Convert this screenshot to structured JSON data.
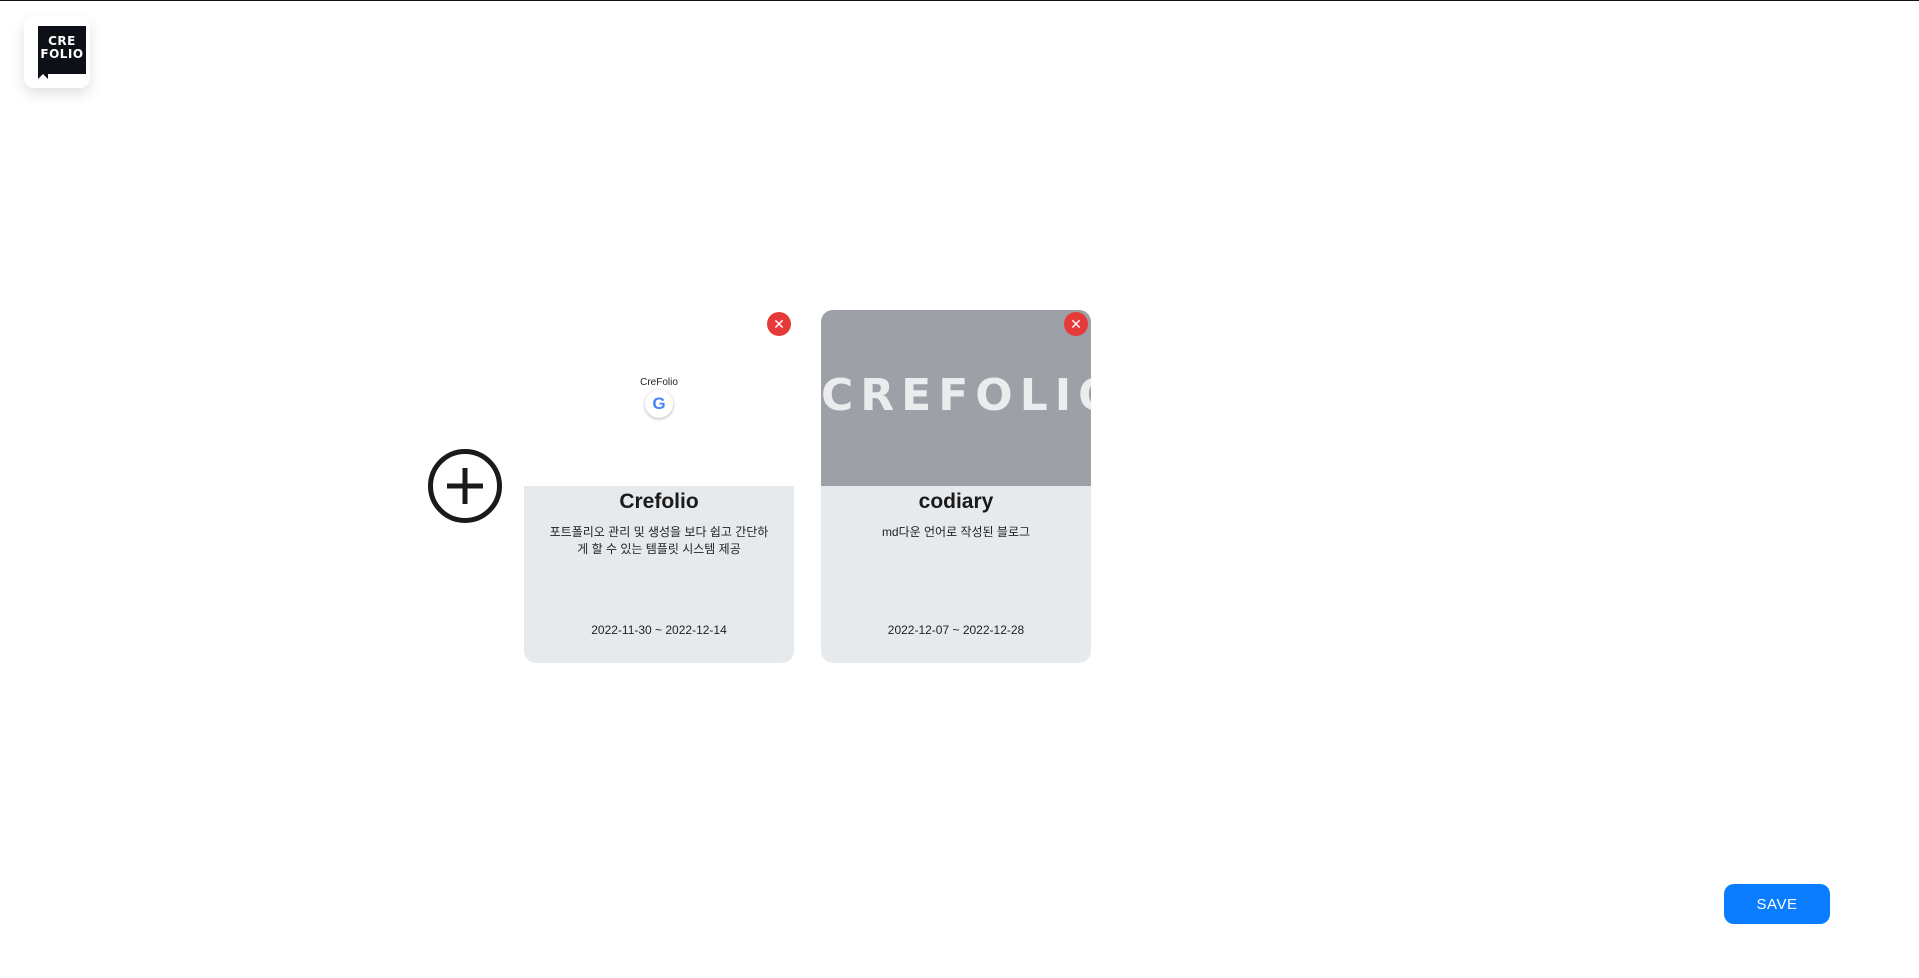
{
  "logo": {
    "line1": "CRE",
    "line2": "FOLIO"
  },
  "add_button": {
    "icon": "plus-circle-icon"
  },
  "projects": [
    {
      "thumbnail": {
        "mini_title": "CreFolio",
        "icon": "google-icon",
        "icon_glyph": "G"
      },
      "title": "Crefolio",
      "description": "포트폴리오 관리 및 생성을 보다 쉽고 간단하게 할 수 있는 템플릿 시스템 제공",
      "dates": "2022-11-30 ~ 2022-12-14",
      "delete_icon": "close-icon",
      "delete_glyph": "✕"
    },
    {
      "thumbnail": {
        "brand_text": "CREFOLIO"
      },
      "title": "codiary",
      "description": "md다운 언어로 작성된 블로그",
      "dates": "2022-12-07 ~ 2022-12-28",
      "delete_icon": "close-icon",
      "delete_glyph": "✕"
    }
  ],
  "save_button": {
    "label": "SAVE"
  },
  "colors": {
    "accent": "#0a7cff",
    "delete": "#e63a3a",
    "card_bg": "#e7eaed",
    "thumb_gray": "#9da0a6"
  }
}
